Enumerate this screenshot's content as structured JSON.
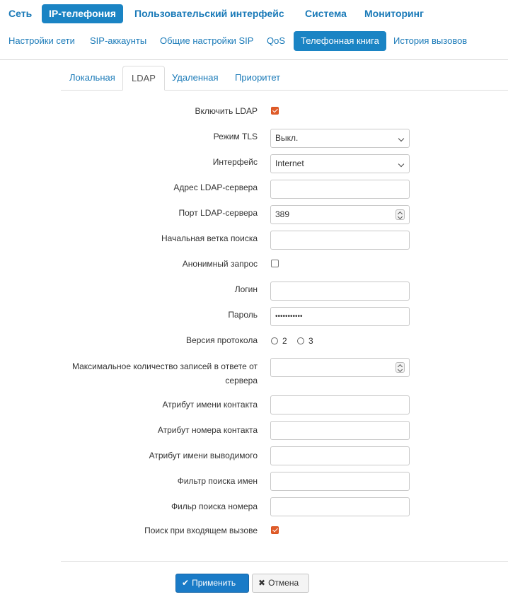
{
  "top_nav": {
    "items": [
      {
        "label": "Сеть"
      },
      {
        "label": "IP-телефония"
      },
      {
        "label": "Пользовательский интерфейс"
      },
      {
        "label": "Система"
      },
      {
        "label": "Мониторинг"
      }
    ],
    "active_index": 1
  },
  "sub_nav": {
    "items": [
      {
        "label": "Настройки сети"
      },
      {
        "label": "SIP-аккаунты"
      },
      {
        "label": "Общие настройки SIP"
      },
      {
        "label": "QoS"
      },
      {
        "label": "Телефонная книга"
      },
      {
        "label": "История вызовов"
      }
    ],
    "active_index": 4
  },
  "tabs": {
    "items": [
      {
        "label": "Локальная"
      },
      {
        "label": "LDAP"
      },
      {
        "label": "Удаленная"
      },
      {
        "label": "Приоритет"
      }
    ],
    "active_index": 1
  },
  "form": {
    "enable_ldap": {
      "label": "Включить LDAP",
      "checked": true
    },
    "tls_mode": {
      "label": "Режим TLS",
      "value": "Выкл."
    },
    "interface": {
      "label": "Интерфейс",
      "value": "Internet"
    },
    "server_address": {
      "label": "Адрес LDAP-сервера",
      "value": ""
    },
    "server_port": {
      "label": "Порт LDAP-сервера",
      "value": "389"
    },
    "search_base": {
      "label": "Начальная ветка поиска",
      "value": ""
    },
    "anonymous": {
      "label": "Анонимный запрос",
      "checked": false
    },
    "login": {
      "label": "Логин",
      "value": ""
    },
    "password": {
      "label": "Пароль",
      "value": "•••••••••••"
    },
    "protocol_version": {
      "label": "Версия протокола",
      "options": [
        "2",
        "3"
      ],
      "selected": null
    },
    "max_entries": {
      "label": "Максимальное количество записей в ответе от сервера",
      "value": ""
    },
    "contact_name_attr": {
      "label": "Атрибут имени контакта",
      "value": ""
    },
    "contact_number_attr": {
      "label": "Атрибут номера контакта",
      "value": ""
    },
    "display_name_attr": {
      "label": "Атрибут имени выводимого",
      "value": ""
    },
    "name_filter": {
      "label": "Фильтр поиска имен",
      "value": ""
    },
    "number_filter": {
      "label": "Фильр поиска номера",
      "value": ""
    },
    "search_on_incoming": {
      "label": "Поиск при входящем вызове",
      "checked": true
    }
  },
  "buttons": {
    "apply": {
      "label": "Применить",
      "icon": "check-icon"
    },
    "cancel": {
      "label": "Отмена",
      "icon": "x-icon"
    }
  },
  "colors": {
    "accent": "#1a84c4",
    "link": "#1a7ab8",
    "checkbox_checked": "#e05c2a"
  }
}
